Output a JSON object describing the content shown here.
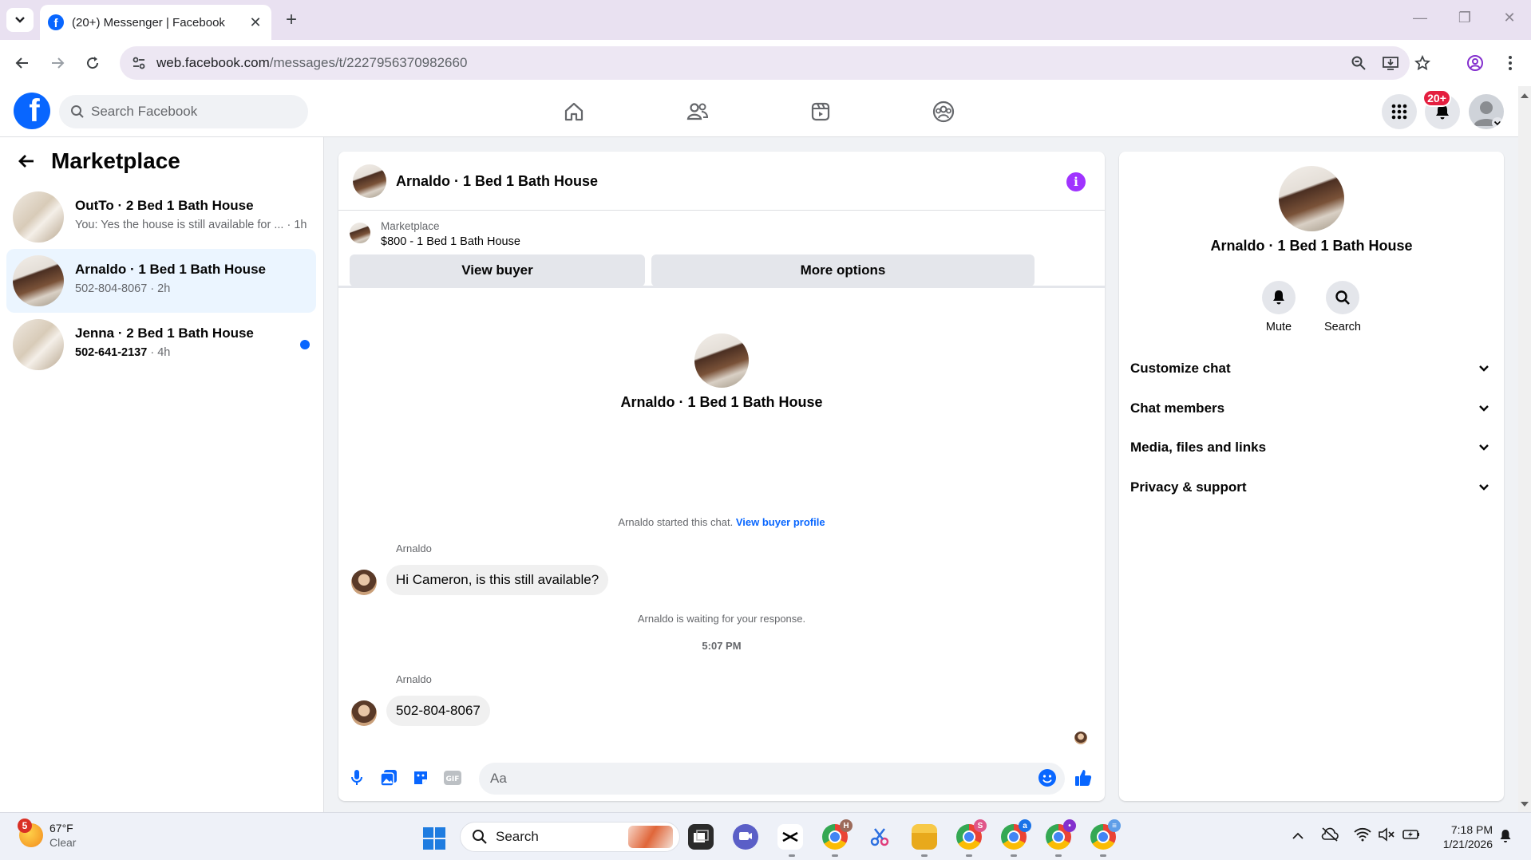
{
  "browser": {
    "tab_title": "(20+) Messenger | Facebook",
    "url_host": "web.facebook.com",
    "url_path": "/messages/t/2227956370982660"
  },
  "fb": {
    "search_placeholder": "Search Facebook",
    "notif_badge": "20+"
  },
  "sidebar": {
    "title": "Marketplace",
    "conversations": [
      {
        "name": "OutTo · 2 Bed 1 Bath House",
        "sub": "You: Yes the house is still available for ... · 1h",
        "unread": false,
        "active": false
      },
      {
        "name": "Arnaldo · 1 Bed 1 Bath House",
        "sub": "502-804-8067 · 2h",
        "unread": false,
        "active": true
      },
      {
        "name": "Jenna · 2 Bed 1 Bath House",
        "sub_bold": "502-641-2137",
        "sub_time": " · 4h",
        "unread": true,
        "active": false
      }
    ]
  },
  "chat": {
    "title": "Arnaldo · 1 Bed 1 Bath House",
    "marketplace_label": "Marketplace",
    "listing": "$800 - 1 Bed 1 Bath House",
    "view_buyer": "View buyer",
    "more_options": "More options",
    "center_name": "Arnaldo · 1 Bed 1 Bath House",
    "started_text": "Arnaldo started this chat.",
    "buyer_profile_link": "View buyer profile",
    "messages": [
      {
        "sender": "Arnaldo",
        "text": "Hi Cameron, is this still available?"
      },
      {
        "sender": "Arnaldo",
        "text": "502-804-8067"
      }
    ],
    "waiting_text": "Arnaldo is waiting for your response.",
    "timestamp": "5:07 PM",
    "input_placeholder": "Aa"
  },
  "details": {
    "name": "Arnaldo · 1 Bed 1 Bath House",
    "mute_label": "Mute",
    "search_label": "Search",
    "sections": [
      "Customize chat",
      "Chat members",
      "Media, files and links",
      "Privacy & support"
    ]
  },
  "taskbar": {
    "weather_badge": "5",
    "temperature": "67°F",
    "condition": "Clear",
    "search_label": "Search",
    "time": "7:18 PM",
    "date": "1/21/2026"
  },
  "colors": {
    "fb_blue": "#0866ff",
    "active_conv": "#ebf5ff",
    "badge_red": "#e41e3f",
    "info_purple": "#a033ff"
  }
}
